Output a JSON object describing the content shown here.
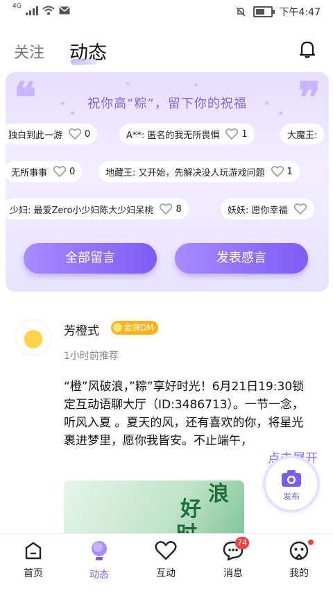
{
  "status_bar": {
    "network": "4G",
    "time": "下午4:47"
  },
  "header": {
    "tab_follow": "关注",
    "tab_dynamic": "动态"
  },
  "wish_board": {
    "title": "祝你高“粽”，留下你的祝福",
    "rows": [
      [
        {
          "text": "独白到此一游",
          "count": "0"
        },
        {
          "text": "A**:  匿名的我无所畏惧",
          "count": "1"
        },
        {
          "text": "大魔王:",
          "count": ""
        }
      ],
      [
        {
          "text": "无所事事",
          "count": "0"
        },
        {
          "text": "地藏王:  又开始，先解决没人玩游戏问题",
          "count": "1"
        }
      ],
      [
        {
          "text": "少妇:  最爱Zero小少妇陈大少妇呆桃",
          "count": "8"
        },
        {
          "text": "妖妖:  愿你幸福",
          "count": ""
        }
      ]
    ],
    "btn_all": "全部留言",
    "btn_post": "发表感言"
  },
  "post": {
    "username": "芳橙式",
    "badge": "金牌DM",
    "time": "1小时前推荐",
    "content": "“橙”风破浪，”粽”享好时光！6月21日19:30锁定互动语聊大厅（ID:3486713）。一节一念，听风入夏 。夏天的风，还有喜欢的你，将星光裹进梦里，愿你我皆安。不止端午，",
    "expand": "点击展开",
    "image_text": [
      "好",
      "浪",
      "时"
    ]
  },
  "fab": {
    "label": "发布"
  },
  "tabbar": {
    "items": [
      {
        "label": "首页"
      },
      {
        "label": "动态"
      },
      {
        "label": "互动"
      },
      {
        "label": "消息",
        "badge": "74"
      },
      {
        "label": "我的"
      }
    ]
  },
  "colors": {
    "accent": "#7d5cf2",
    "badge_red": "#f04444",
    "gold": "#ffb21a"
  }
}
